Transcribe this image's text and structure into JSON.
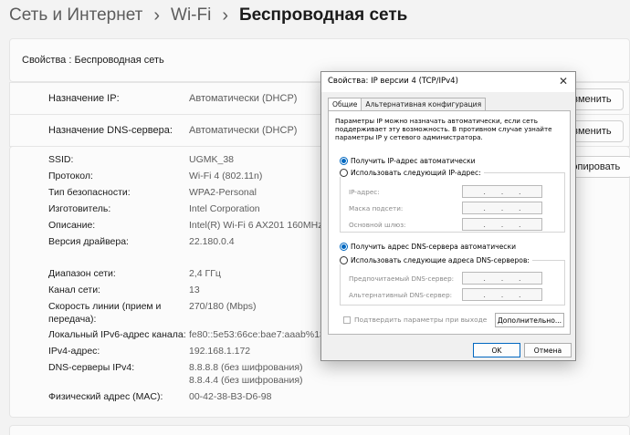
{
  "breadcrumb": {
    "items": [
      "Сеть и Интернет",
      "Wi-Fi",
      "Беспроводная сеть"
    ],
    "separator": "›"
  },
  "header": {
    "title": "Свойства : Беспроводная сеть"
  },
  "ip_row": {
    "label": "Назначение IP:",
    "value": "Автоматически (DHCP)",
    "button": "Изменить"
  },
  "dns_row": {
    "label": "Назначение DNS-сервера:",
    "value": "Автоматически (DHCP)",
    "button": "Изменить"
  },
  "props_button": "Копировать",
  "properties": [
    {
      "label": "SSID:",
      "value": "UGMK_38"
    },
    {
      "label": "Протокол:",
      "value": "Wi-Fi 4 (802.11n)"
    },
    {
      "label": "Тип безопасности:",
      "value": "WPA2-Personal"
    },
    {
      "label": "Изготовитель:",
      "value": "Intel Corporation"
    },
    {
      "label": "Описание:",
      "value": "Intel(R) Wi-Fi 6 AX201 160MHz"
    },
    {
      "label": "Версия драйвера:",
      "value": "22.180.0.4"
    },
    {
      "label": "Диапазон сети:",
      "value": "2,4 ГГц"
    },
    {
      "label": "Канал сети:",
      "value": "13"
    },
    {
      "label": "Скорость линии (прием и передача):",
      "value": "270/180 (Mbps)"
    },
    {
      "label": "Локальный IPv6-адрес канала:",
      "value": "fe80::5e53:66ce:bae7:aaab%13"
    },
    {
      "label": "IPv4-адрес:",
      "value": "192.168.1.172"
    },
    {
      "label": "DNS-серверы IPv4:",
      "value": "8.8.8.8 (без шифрования)",
      "value2": "8.8.4.4 (без шифрования)"
    },
    {
      "label": "Физический адрес (MAC):",
      "value": "00-42-38-B3-D6-98"
    }
  ],
  "dialog": {
    "title": "Свойства: IP версии 4 (TCP/IPv4)",
    "close": "✕",
    "tabs": [
      "Общие",
      "Альтернативная конфигурация"
    ],
    "description": "Параметры IP можно назначать автоматически, если сеть поддерживает эту возможность. В противном случае узнайте параметры IP у сетевого администратора.",
    "ip_auto": "Получить IP-адрес автоматически",
    "ip_manual": "Использовать следующий IP-адрес:",
    "ip_fields": [
      "IP-адрес:",
      "Маска подсети:",
      "Основной шлюз:"
    ],
    "dns_auto": "Получить адрес DNS-сервера автоматически",
    "dns_manual": "Использовать следующие адреса DNS-серверов:",
    "dns_fields": [
      "Предпочитаемый DNS-сервер:",
      "Альтернативный DNS-сервер:"
    ],
    "validate": "Подтвердить параметры при выходе",
    "advanced": "Дополнительно...",
    "ok": "OK",
    "cancel": "Отмена",
    "ip_dots": "."
  }
}
